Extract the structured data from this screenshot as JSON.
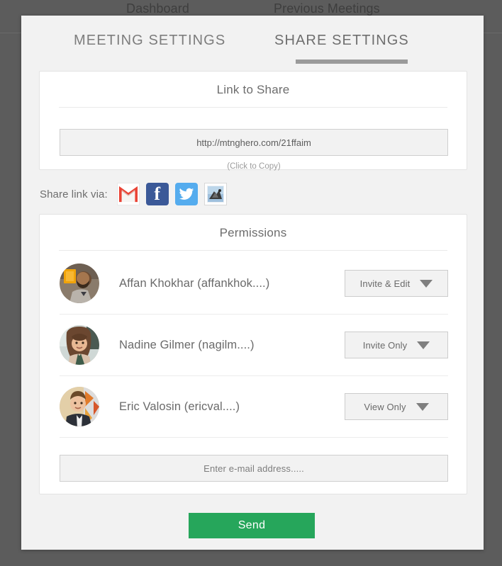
{
  "background": {
    "nav_items": [
      {
        "label": "Dashboard"
      },
      {
        "label": "Previous Meetings"
      }
    ]
  },
  "modal": {
    "tabs": [
      {
        "label": "MEETING SETTINGS",
        "active": false
      },
      {
        "label": "SHARE SETTINGS",
        "active": true
      }
    ],
    "link_card": {
      "title": "Link to Share",
      "url": "http://mtnghero.com/21ffaim",
      "hint": "(Click to Copy)"
    },
    "share_via": {
      "label": "Share link via:",
      "icons": [
        {
          "name": "gmail-icon",
          "label": "Gmail",
          "color": "#d93025"
        },
        {
          "name": "facebook-icon",
          "label": "Facebook",
          "color": "#3b5998"
        },
        {
          "name": "twitter-icon",
          "label": "Twitter",
          "color": "#55acee"
        },
        {
          "name": "apple-mail-icon",
          "label": "Mail",
          "color": "#bfd4e8"
        }
      ]
    },
    "permissions": {
      "title": "Permissions",
      "rows": [
        {
          "name": "Affan Khokhar (affankhok....)",
          "permission": "Invite & Edit"
        },
        {
          "name": "Nadine Gilmer (nagilm....)",
          "permission": "Invite Only"
        },
        {
          "name": "Eric Valosin (ericval....)",
          "permission": "View Only"
        }
      ],
      "email_placeholder": "Enter e-mail address....."
    },
    "send_label": "Send",
    "accent_color": "#26a65b"
  }
}
